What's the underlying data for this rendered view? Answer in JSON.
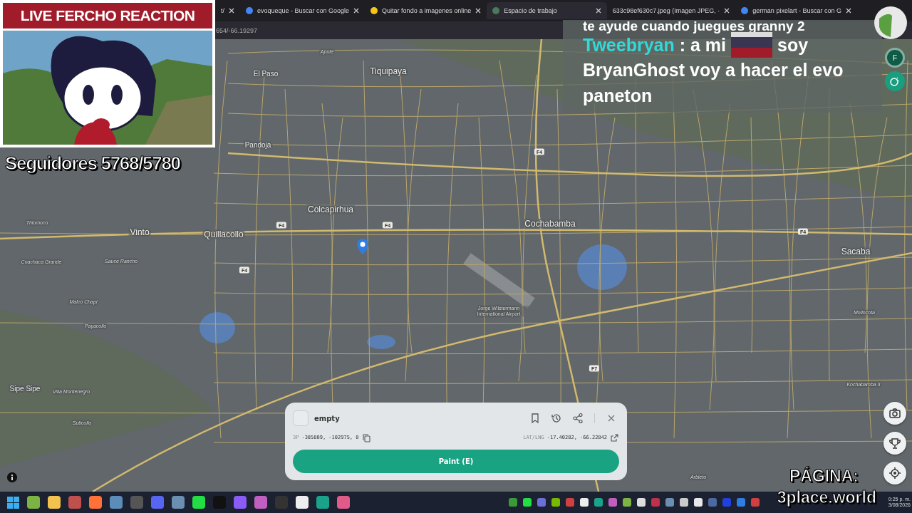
{
  "browser": {
    "tabs": [
      {
        "title": "t/",
        "selected": false
      },
      {
        "title": "evoqueque - Buscar con Google",
        "selected": false
      },
      {
        "title": "Quitar fondo a imagenes online",
        "selected": false
      },
      {
        "title": "Espacio de trabajo",
        "selected": true
      },
      {
        "title": "633c98ef630c7.jpeg (Imagen JPEG, ·",
        "selected": false
      },
      {
        "title": "german pixelart - Buscar con G",
        "selected": false
      }
    ],
    "address": "654/-66.19297"
  },
  "map": {
    "places": [
      {
        "name": "Tiquipaya",
        "kind": "city"
      },
      {
        "name": "El Paso",
        "kind": "town"
      },
      {
        "name": "Apote",
        "kind": "small"
      },
      {
        "name": "Pandoja",
        "kind": "town"
      },
      {
        "name": "Colcapirhua",
        "kind": "city"
      },
      {
        "name": "Vinto",
        "kind": "city"
      },
      {
        "name": "Quillacollo",
        "kind": "city"
      },
      {
        "name": "Cochabamba",
        "kind": "city"
      },
      {
        "name": "Sacaba",
        "kind": "city"
      },
      {
        "name": "Thiomoco",
        "kind": "small"
      },
      {
        "name": "Coachaca Grande",
        "kind": "small"
      },
      {
        "name": "Sauce Rancho",
        "kind": "small"
      },
      {
        "name": "Malco Chapi",
        "kind": "small"
      },
      {
        "name": "Payacollo",
        "kind": "small"
      },
      {
        "name": "Sipe Sipe",
        "kind": "town"
      },
      {
        "name": "Villa Montenegro",
        "kind": "small"
      },
      {
        "name": "Suticollo",
        "kind": "small"
      },
      {
        "name": "Mollocota",
        "kind": "small"
      },
      {
        "name": "Kochabamba II",
        "kind": "small"
      },
      {
        "name": "Arbieto",
        "kind": "small"
      },
      {
        "name": "Jorge Wilstermann International Airport",
        "kind": "airport"
      }
    ],
    "road_shields": [
      "F4",
      "F4",
      "F4",
      "F4",
      "F4",
      "F7"
    ]
  },
  "map_controls": {
    "avatar": "F"
  },
  "pixel_panel": {
    "color_name": "empty",
    "coords_label": "3P",
    "coords": "-385809, -102975, 0",
    "latlng_label": "LAT/LNG",
    "latlng": "-17.40282, -66.22842",
    "paint_button": "Paint (E)"
  },
  "overlay": {
    "title": "LIVE FERCHO REACTION",
    "followers": "Seguidores 5768/5780",
    "chat": [
      {
        "kind": "partial",
        "text": "te ayude cuando juegues granny 2"
      },
      {
        "kind": "user",
        "user": "Tweebryan",
        "text": ": a mi",
        "text_after": "soy"
      },
      {
        "kind": "plain",
        "text": "BryanGhost voy a hacer el evo paneton"
      }
    ],
    "page_label": "PÁGINA:",
    "page_url": "3place.world"
  },
  "taskbar": {
    "time": "0:25 p. m.",
    "date": "3/08/2026"
  }
}
